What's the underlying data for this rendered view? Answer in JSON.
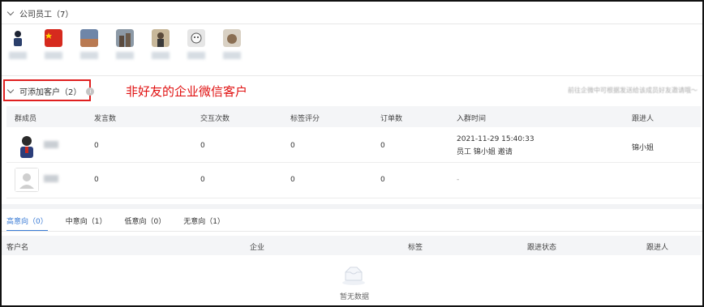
{
  "staff_section": {
    "title": "公司员工（7）"
  },
  "staff_avatars": [
    {
      "name_icon": "avatar-person-icon",
      "color": "#2b3f6b"
    },
    {
      "name_icon": "avatar-flag-icon",
      "color": "#c8281e"
    },
    {
      "name_icon": "avatar-landscape-icon",
      "color": "#7a8ba6"
    },
    {
      "name_icon": "avatar-city-icon",
      "color": "#8a7a6a"
    },
    {
      "name_icon": "avatar-figure-icon",
      "color": "#9a8670"
    },
    {
      "name_icon": "avatar-cartoon-icon",
      "color": "#c9c9c9"
    },
    {
      "name_icon": "avatar-animal-icon",
      "color": "#a89884"
    }
  ],
  "addable_section": {
    "title": "可添加客户（2）",
    "info": "i"
  },
  "annotation": "非好友的企业微信客户",
  "top_right_note": "前往企微中可根据发送给该成员好友邀请哦～",
  "member_table": {
    "headers": [
      "群成员",
      "发言数",
      "交互次数",
      "标签评分",
      "订单数",
      "入群时间",
      "跟进人"
    ],
    "rows": [
      {
        "msgs": "0",
        "interactions": "0",
        "score": "0",
        "orders": "0",
        "join_time": "2021-11-29 15:40:33",
        "join_detail": "员工 锦小姐 邀请",
        "follower": "锦小姐"
      },
      {
        "msgs": "0",
        "interactions": "0",
        "score": "0",
        "orders": "0",
        "join_time": "-",
        "join_detail": "",
        "follower": ""
      }
    ]
  },
  "intent_tabs": [
    {
      "label": "高意向（0）",
      "active": true
    },
    {
      "label": "中意向（1）",
      "active": false
    },
    {
      "label": "低意向（0）",
      "active": false
    },
    {
      "label": "无意向（1）",
      "active": false
    }
  ],
  "customer_table": {
    "headers": [
      "客户名",
      "企业",
      "标签",
      "跟进状态",
      "跟进人"
    ]
  },
  "empty_text": "暂无数据",
  "colors": {
    "accent": "#3a7bd5",
    "annotation_red": "#e01010"
  }
}
